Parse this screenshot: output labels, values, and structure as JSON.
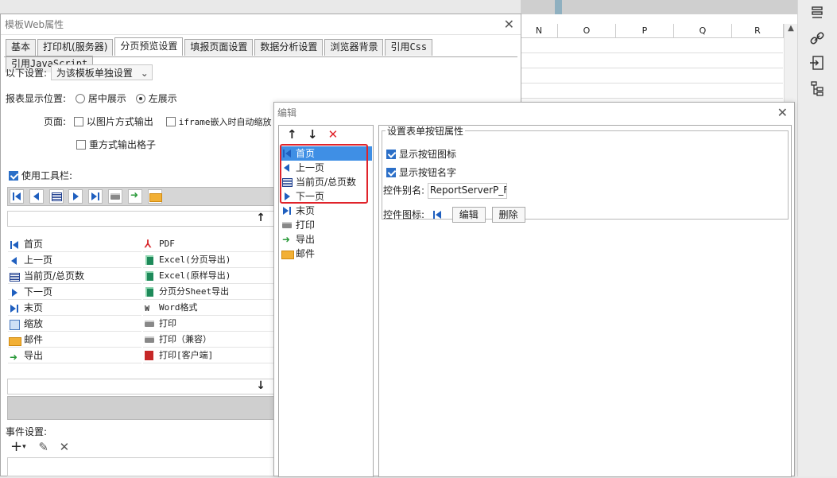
{
  "sheet": {
    "columns": [
      "N",
      "O",
      "P",
      "Q",
      "R"
    ]
  },
  "main": {
    "title": "模板Web属性",
    "tabs": [
      "基本",
      "打印机(服务器)",
      "分页预览设置",
      "填报页面设置",
      "数据分析设置",
      "浏览器背景",
      "引用Css",
      "引用JavaScript"
    ],
    "apply_label": "以下设置:",
    "apply_value": "为该模板单独设置",
    "position_label": "报表显示位置:",
    "position_center": "居中展示",
    "position_left": "左展示",
    "page_label": "页面:",
    "opt_image": "以图片方式输出",
    "opt_iframe": "iframe嵌入时自动缩放",
    "opt_redo": "重方式输出格子",
    "use_toolbar": "使用工具栏:",
    "left_items": [
      "首页",
      "上一页",
      "当前页/总页数",
      "下一页",
      "末页",
      "缩放",
      "邮件",
      "导出"
    ],
    "right_items": [
      "PDF",
      "Excel(分页导出)",
      "Excel(原样导出)",
      "分页分Sheet导出",
      "Word格式",
      "打印",
      "打印（兼容）",
      "打印[客户端]"
    ],
    "events_label": "事件设置:"
  },
  "edit": {
    "title": "编辑",
    "list": [
      "首页",
      "上一页",
      "当前页/总页数",
      "下一页",
      "末页",
      "打印",
      "导出",
      "邮件"
    ],
    "group_title": "设置表单按钮属性",
    "show_icon": "显示按钮图标",
    "show_name": "显示按钮名字",
    "alias_label": "控件别名:",
    "alias_value": "ReportServerP_First')}",
    "icon_label": "控件图标:",
    "edit_btn": "编辑",
    "delete_btn": "删除"
  },
  "colors": {
    "accent": "#3f8fe5",
    "highlight_box": "#e0232a"
  }
}
